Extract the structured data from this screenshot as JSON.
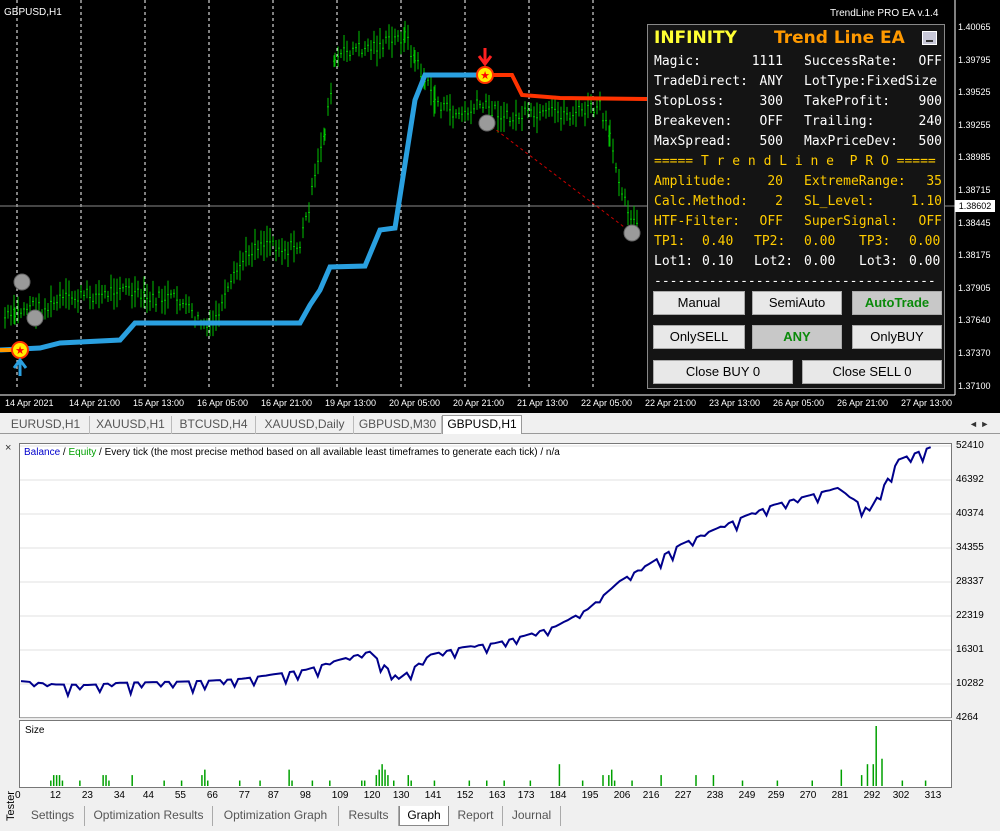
{
  "chart": {
    "symbol": "GBPUSD,H1",
    "ea_name": "TrendLine PRO EA  v.1.4",
    "current_price": "1.38602",
    "price_ticks": [
      "1.40065",
      "1.39795",
      "1.39525",
      "1.39255",
      "1.38985",
      "1.38715",
      "1.38445",
      "1.38175",
      "1.37905",
      "1.37640",
      "1.37370",
      "1.37100"
    ],
    "time_ticks": [
      "14 Apr 2021",
      "14 Apr 21:00",
      "15 Apr 13:00",
      "16 Apr 05:00",
      "16 Apr 21:00",
      "19 Apr 13:00",
      "20 Apr 05:00",
      "20 Apr 21:00",
      "21 Apr 13:00",
      "22 Apr 05:00",
      "22 Apr 21:00",
      "23 Apr 13:00",
      "26 Apr 05:00",
      "26 Apr 21:00",
      "27 Apr 13:00"
    ],
    "colors": {
      "bull": "#00c000",
      "support_line": "#2aa0e0",
      "resistance_line": "#ff3300",
      "signal_line": "#cc0000"
    }
  },
  "ea_panel": {
    "title_left": "INFINITY",
    "title_right": "Trend Line EA",
    "rows": [
      [
        {
          "t": "Magic:",
          "c": "w"
        },
        {
          "t": "1111",
          "c": "w"
        },
        {
          "t": "SuccessRate:",
          "c": "w"
        },
        {
          "t": "OFF",
          "c": "w"
        }
      ],
      [
        {
          "t": "TradeDirect:",
          "c": "w"
        },
        {
          "t": "ANY",
          "c": "w"
        },
        {
          "t": "LotType:FixedSize",
          "c": "w"
        }
      ],
      [
        {
          "t": "StopLoss:",
          "c": "w"
        },
        {
          "t": "300",
          "c": "w"
        },
        {
          "t": "TakeProfit:",
          "c": "w"
        },
        {
          "t": "900",
          "c": "w"
        }
      ],
      [
        {
          "t": "Breakeven:",
          "c": "w"
        },
        {
          "t": "OFF",
          "c": "w"
        },
        {
          "t": "Trailing:",
          "c": "w"
        },
        {
          "t": "240",
          "c": "w"
        }
      ],
      [
        {
          "t": "MaxSpread:",
          "c": "w"
        },
        {
          "t": "500",
          "c": "w"
        },
        {
          "t": "MaxPriceDev:",
          "c": "w"
        },
        {
          "t": "500",
          "c": "w"
        }
      ],
      [
        {
          "t": "===== T r e n d L i n e  P R O =====",
          "c": "y"
        }
      ],
      [
        {
          "t": "Amplitude:",
          "c": "y"
        },
        {
          "t": "20",
          "c": "y"
        },
        {
          "t": "ExtremeRange:",
          "c": "y"
        },
        {
          "t": "35",
          "c": "y"
        }
      ],
      [
        {
          "t": "Calc.Method:",
          "c": "y"
        },
        {
          "t": "2",
          "c": "y"
        },
        {
          "t": "SL_Level:",
          "c": "y"
        },
        {
          "t": "1.10",
          "c": "y"
        }
      ],
      [
        {
          "t": "HTF-Filter:",
          "c": "y"
        },
        {
          "t": "OFF",
          "c": "y"
        },
        {
          "t": "SuperSignal:",
          "c": "y"
        },
        {
          "t": "OFF",
          "c": "y"
        }
      ],
      [
        {
          "t": "TP1:",
          "c": "y"
        },
        {
          "t": "0.40",
          "c": "y"
        },
        {
          "t": "TP2:",
          "c": "y"
        },
        {
          "t": "0.00",
          "c": "y"
        },
        {
          "t": "TP3:",
          "c": "y"
        },
        {
          "t": "0.00",
          "c": "y"
        }
      ],
      [
        {
          "t": "Lot1:",
          "c": "w"
        },
        {
          "t": "0.10",
          "c": "w"
        },
        {
          "t": "Lot2:",
          "c": "w"
        },
        {
          "t": "0.00",
          "c": "w"
        },
        {
          "t": "Lot3:",
          "c": "w"
        },
        {
          "t": "0.00",
          "c": "w"
        }
      ],
      [
        {
          "t": "------------------------------------",
          "c": "w"
        }
      ]
    ],
    "buttons": {
      "manual": "Manual",
      "semiauto": "SemiAuto",
      "autotrade": "AutoTrade",
      "onlysell": "OnlySELL",
      "any": "ANY",
      "onlybuy": "OnlyBUY",
      "close_buy": "Close BUY 0",
      "close_sell": "Close SELL 0"
    }
  },
  "chart_tabs": [
    "EURUSD,H1",
    "XAUUSD,H1",
    "BTCUSD,H4",
    "XAUUSD,Daily",
    "GBPUSD,M30",
    "GBPUSD,H1"
  ],
  "chart_tabs_selected": "GBPUSD,H1",
  "tester": {
    "side_label": "Tester",
    "legend_balance": "Balance",
    "legend_sep1": " / ",
    "legend_equity": "Equity",
    "legend_rest": " / Every tick (the most precise method based on all available least timeframes to generate each tick) / n/a",
    "size_label": "Size",
    "tabs": [
      "Settings",
      "Optimization Results",
      "Optimization Graph",
      "Results",
      "Graph",
      "Report",
      "Journal"
    ],
    "selected_tab": "Graph"
  },
  "chart_data": [
    {
      "type": "line",
      "title": "",
      "series": [
        {
          "name": "Balance",
          "color": "#00008b"
        }
      ],
      "x": [
        0,
        12,
        23,
        34,
        44,
        55,
        66,
        76,
        87,
        98,
        109,
        120,
        130,
        141,
        152,
        163,
        173,
        184,
        195,
        206,
        216,
        227,
        238,
        249,
        259,
        270,
        281,
        292,
        302,
        313
      ],
      "y": [
        10800,
        10200,
        10100,
        10500,
        10600,
        10700,
        10900,
        11200,
        12000,
        12800,
        14500,
        16000,
        11200,
        15500,
        16800,
        17500,
        18800,
        20500,
        23500,
        28500,
        31500,
        35000,
        37500,
        40000,
        42000,
        43500,
        45000,
        41000,
        50000,
        52200
      ],
      "yticks": [
        4264,
        10282,
        16301,
        22319,
        28337,
        34355,
        40374,
        46392,
        52410
      ],
      "xticks": [
        0,
        12,
        23,
        34,
        44,
        55,
        66,
        77,
        87,
        98,
        109,
        120,
        130,
        141,
        152,
        163,
        173,
        184,
        195,
        206,
        216,
        227,
        238,
        249,
        259,
        270,
        281,
        292,
        302,
        313
      ],
      "ylim": [
        4264,
        52410
      ]
    },
    {
      "type": "bar",
      "title": "",
      "series": [
        {
          "name": "Size",
          "color": "#00a000"
        }
      ],
      "values_note": "trade size per trade index",
      "x": [
        10,
        11,
        12,
        13,
        14,
        20,
        28,
        29,
        30,
        38,
        49,
        55,
        62,
        63,
        64,
        75,
        82,
        92,
        93,
        100,
        106,
        117,
        118,
        122,
        123,
        124,
        125,
        126,
        128,
        133,
        134,
        142,
        154,
        160,
        166,
        175,
        185,
        193,
        200,
        202,
        203,
        204,
        210,
        220,
        232,
        238,
        248,
        260,
        272,
        282,
        289,
        291,
        293,
        294,
        296,
        303,
        311
      ],
      "y": [
        1,
        2,
        2,
        2,
        1,
        1,
        2,
        2,
        1,
        2,
        1,
        1,
        2,
        3,
        1,
        1,
        1,
        3,
        1,
        1,
        1,
        1,
        1,
        2,
        3,
        4,
        3,
        2,
        1,
        2,
        1,
        1,
        1,
        1,
        1,
        1,
        4,
        1,
        2,
        2,
        3,
        1,
        1,
        2,
        2,
        2,
        1,
        1,
        1,
        3,
        2,
        4,
        4,
        11,
        5,
        1,
        1
      ]
    }
  ]
}
